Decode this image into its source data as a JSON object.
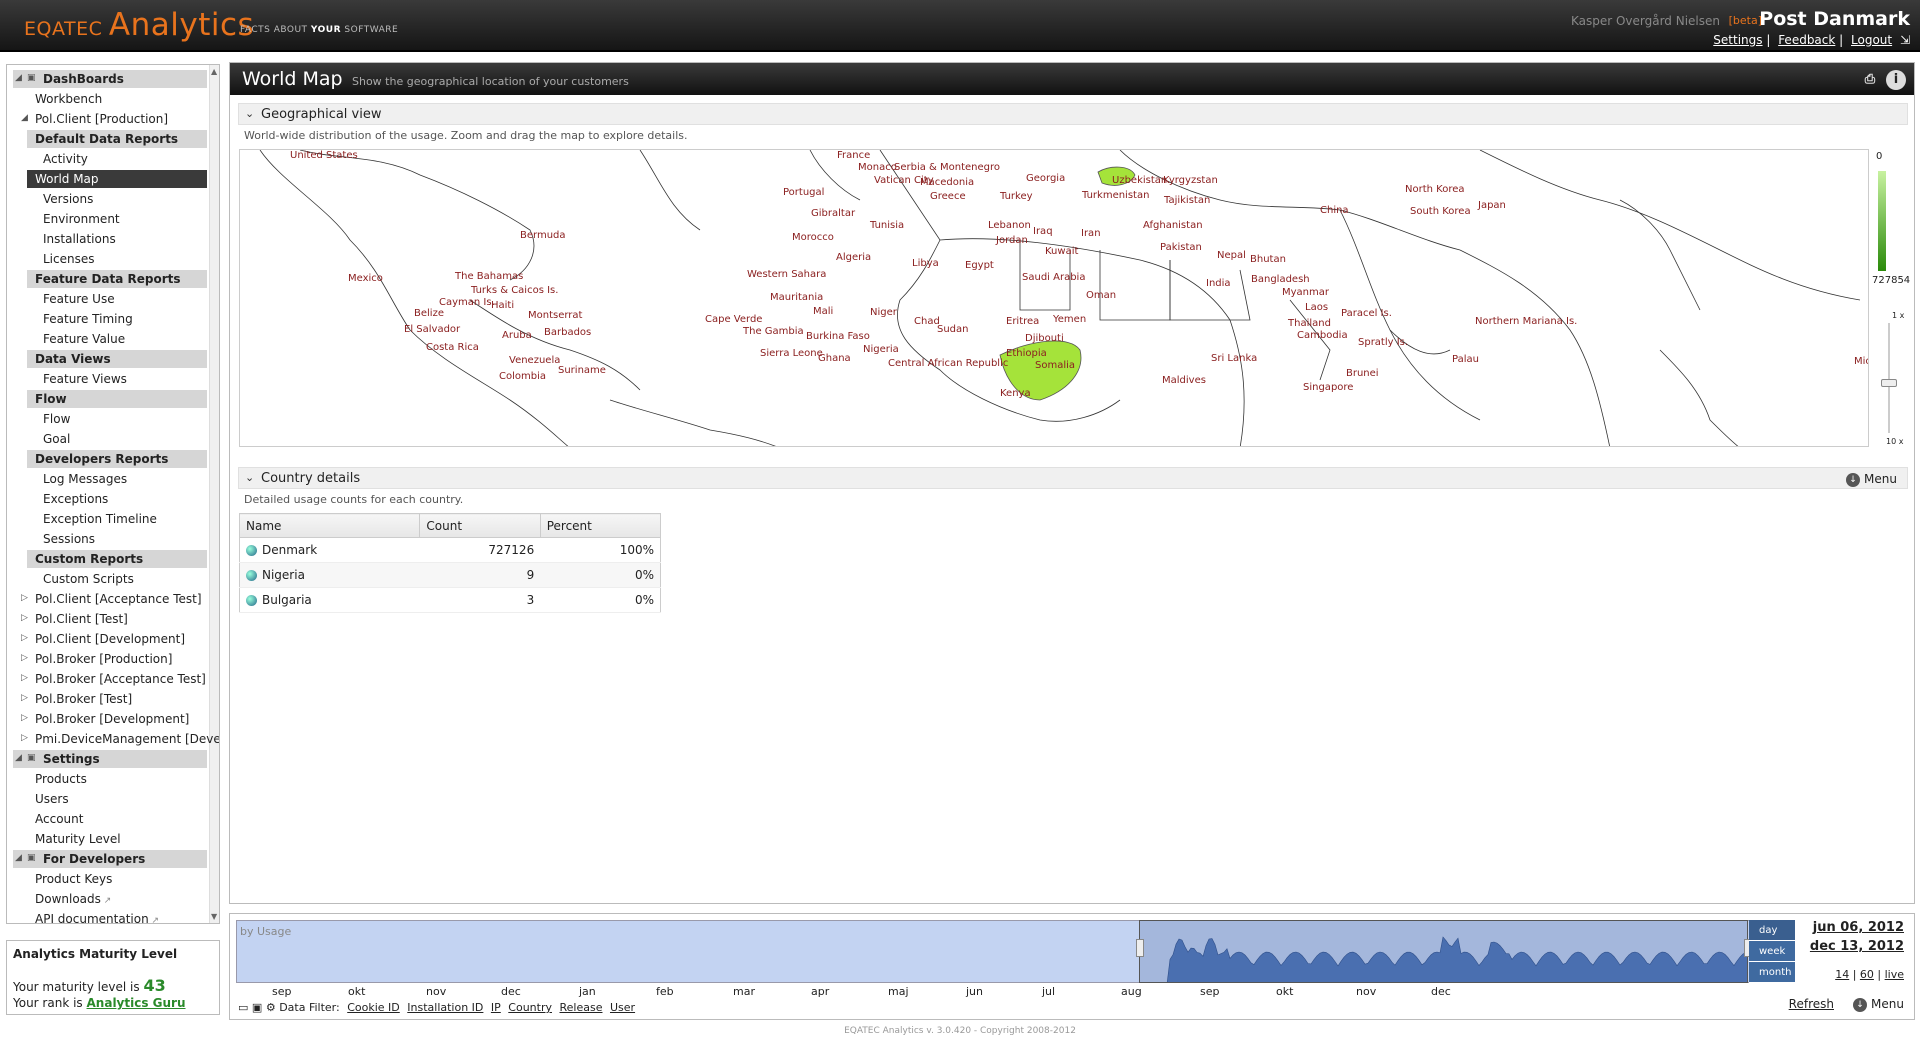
{
  "header": {
    "brand_prefix": "EQATEC",
    "brand_name": "Analytics",
    "tagline_1": "FACTS ABOUT",
    "tagline_2": "YOUR",
    "tagline_3": "SOFTWARE",
    "user_name": "Kasper Overgård Nielsen",
    "beta_label": "[beta]",
    "org_name": "Post Danmark",
    "links": {
      "settings": "Settings",
      "feedback": "Feedback",
      "logout": "Logout"
    }
  },
  "sidebar": {
    "items": [
      {
        "label": "DashBoards",
        "type": "header"
      },
      {
        "label": "Workbench",
        "type": "item"
      },
      {
        "label": "Pol.Client [Production]",
        "type": "item"
      },
      {
        "label": "Default Data Reports",
        "type": "subheader"
      },
      {
        "label": "Activity",
        "type": "item"
      },
      {
        "label": "World Map",
        "type": "selected"
      },
      {
        "label": "Versions",
        "type": "item"
      },
      {
        "label": "Environment",
        "type": "item"
      },
      {
        "label": "Installations",
        "type": "item"
      },
      {
        "label": "Licenses",
        "type": "item"
      },
      {
        "label": "Feature Data Reports",
        "type": "subheader"
      },
      {
        "label": "Feature Use",
        "type": "item"
      },
      {
        "label": "Feature Timing",
        "type": "item"
      },
      {
        "label": "Feature Value",
        "type": "item"
      },
      {
        "label": "Data Views",
        "type": "subheader"
      },
      {
        "label": "Feature Views",
        "type": "item"
      },
      {
        "label": "Flow",
        "type": "subheader"
      },
      {
        "label": "Flow",
        "type": "item"
      },
      {
        "label": "Goal",
        "type": "item"
      },
      {
        "label": "Developers Reports",
        "type": "subheader"
      },
      {
        "label": "Log Messages",
        "type": "item"
      },
      {
        "label": "Exceptions",
        "type": "item"
      },
      {
        "label": "Exception Timeline",
        "type": "item"
      },
      {
        "label": "Sessions",
        "type": "item"
      },
      {
        "label": "Custom Reports",
        "type": "subheader"
      },
      {
        "label": "Custom Scripts",
        "type": "item"
      },
      {
        "label": "Pol.Client [Acceptance Test]",
        "type": "item"
      },
      {
        "label": "Pol.Client [Test]",
        "type": "item"
      },
      {
        "label": "Pol.Client [Development]",
        "type": "item"
      },
      {
        "label": "Pol.Broker [Production]",
        "type": "item"
      },
      {
        "label": "Pol.Broker [Acceptance Test]",
        "type": "item"
      },
      {
        "label": "Pol.Broker [Test]",
        "type": "item"
      },
      {
        "label": "Pol.Broker [Development]",
        "type": "item"
      },
      {
        "label": "Pmi.DeviceManagement [Deve",
        "type": "item"
      },
      {
        "label": "Settings",
        "type": "header"
      },
      {
        "label": "Products",
        "type": "item"
      },
      {
        "label": "Users",
        "type": "item"
      },
      {
        "label": "Account",
        "type": "item"
      },
      {
        "label": "Maturity Level",
        "type": "item"
      },
      {
        "label": "For Developers",
        "type": "header"
      },
      {
        "label": "Product Keys",
        "type": "item"
      },
      {
        "label": "Downloads",
        "type": "item"
      },
      {
        "label": "API documentation",
        "type": "item"
      }
    ]
  },
  "maturity": {
    "title": "Analytics Maturity Level",
    "level_text": "Your maturity level is",
    "level": "43",
    "rank_text": "Your rank is",
    "rank": "Analytics Guru"
  },
  "page": {
    "title": "World Map",
    "subtitle": "Show the geographical location of your customers"
  },
  "geo": {
    "section_title": "Geographical view",
    "description": "World-wide distribution of the usage. Zoom and drag the map to explore details.",
    "legend_min": "0",
    "legend_max": "727854",
    "zoom_top": "1 x",
    "zoom_bottom": "10 x",
    "highlight_color": "#a5e33a",
    "labels": [
      "United States",
      "France",
      "Monaco",
      "Serbia & Montenegro",
      "Vatican City",
      "Macedonia",
      "Georgia",
      "Uzbekistan",
      "Kyrgyzstan",
      "Portugal",
      "Greece",
      "Turkey",
      "Turkmenistan",
      "Tajikistan",
      "North Korea",
      "Gibraltar",
      "Japan",
      "China",
      "South Korea",
      "Tunisia",
      "Lebanon",
      "Iraq",
      "Iran",
      "Afghanistan",
      "Bermuda",
      "Morocco",
      "Jordan",
      "Kuwait",
      "Pakistan",
      "Algeria",
      "Libya",
      "Egypt",
      "Nepal",
      "Bhutan",
      "Mexico",
      "The Bahamas",
      "Western Sahara",
      "Saudi Arabia",
      "Bangladesh",
      "India",
      "Turks & Caicos Is.",
      "Mauritania",
      "Myanmar",
      "Cayman Is.",
      "Haiti",
      "Montserrat",
      "Mali",
      "Niger",
      "Oman",
      "Laos",
      "Cape Verde",
      "Chad",
      "Yemen",
      "Eritrea",
      "Paracel Is.",
      "Thailand",
      "Northern Mariana Is.",
      "Belize",
      "Barbados",
      "The Gambia",
      "Burkina Faso",
      "Sudan",
      "Djibouti",
      "El Salvador",
      "Aruba",
      "Cambodia",
      "Spratly Is.",
      "Nigeria",
      "Costa Rica",
      "Sierra Leone",
      "Ghana",
      "Ethiopia",
      "Venezuela",
      "Central African Republic",
      "Sri Lanka",
      "Palau",
      "Somalia",
      "Micr",
      "Suriname",
      "Colombia",
      "Brunei",
      "Maldives",
      "Singapore",
      "Kenya"
    ]
  },
  "country": {
    "section_title": "Country details",
    "description": "Detailed usage counts for each country.",
    "menu_label": "Menu",
    "columns": [
      "Name",
      "Count",
      "Percent"
    ],
    "rows": [
      {
        "name": "Denmark",
        "count": "727126",
        "percent": "100%"
      },
      {
        "name": "Nigeria",
        "count": "9",
        "percent": "0%"
      },
      {
        "name": "Bulgaria",
        "count": "3",
        "percent": "0%"
      }
    ]
  },
  "timeline": {
    "series_label": "by Usage",
    "months": [
      "sep",
      "okt",
      "nov",
      "dec",
      "jan",
      "feb",
      "mar",
      "apr",
      "maj",
      "jun",
      "jul",
      "aug",
      "sep",
      "okt",
      "nov",
      "dec"
    ],
    "granularity": [
      "day",
      "week",
      "month"
    ],
    "date_from": "jun 06, 2012",
    "date_to": "dec 13, 2012",
    "periods": [
      "14",
      "60",
      "live"
    ],
    "refresh_label": "Refresh",
    "menu_label": "Menu",
    "filter_label": "Data Filter:",
    "filters": [
      "Cookie ID",
      "Installation ID",
      "IP",
      "Country",
      "Release",
      "User"
    ]
  },
  "footer": {
    "text": "EQATEC Analytics v. 3.0.420 - Copyright 2008-2012"
  }
}
